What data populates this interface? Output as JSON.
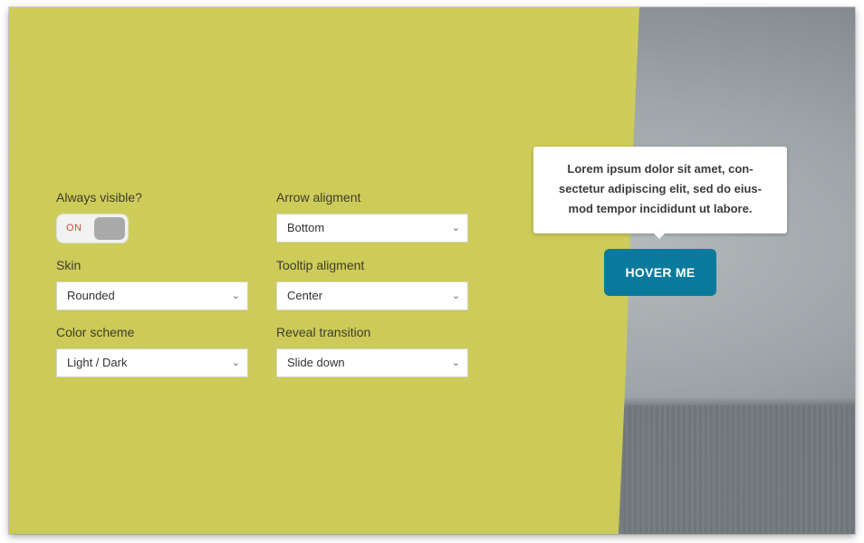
{
  "controls": {
    "always_visible": {
      "label": "Always visible?",
      "state": "ON"
    },
    "arrow_alignment": {
      "label": "Arrow aligment",
      "value": "Bottom"
    },
    "skin": {
      "label": "Skin",
      "value": "Rounded"
    },
    "tooltip_alignment": {
      "label": "Tooltip aligment",
      "value": "Center"
    },
    "color_scheme": {
      "label": "Color scheme",
      "value": "Light / Dark"
    },
    "reveal_transition": {
      "label": "Reveal transition",
      "value": "Slide down"
    }
  },
  "tooltip": {
    "text": "Lorem ipsum dolor sit amet, con-sectetur adipiscing elit, sed do eius-mod tempor incididunt ut labore."
  },
  "hover_button": {
    "label": "HOVER ME"
  },
  "icons": {
    "select_chevron": "chevron-down-icon"
  },
  "colors": {
    "panel": "#cccb58",
    "button": "#0a7a9c",
    "toggle_on_text": "#d0473a"
  }
}
